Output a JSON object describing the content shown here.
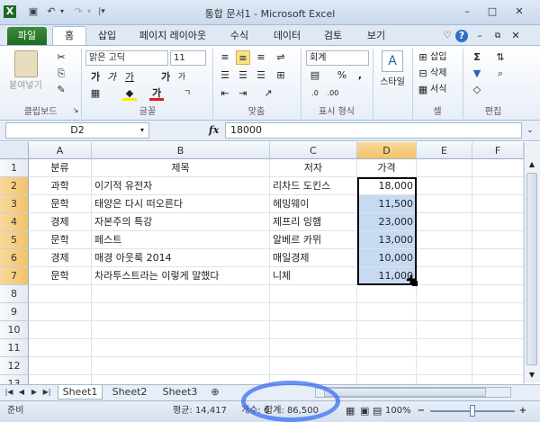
{
  "window": {
    "title": "통합 문서1 - Microsoft Excel"
  },
  "tabs": [
    "파일",
    "홈",
    "삽입",
    "페이지 레이아웃",
    "수식",
    "데이터",
    "검토",
    "보기"
  ],
  "ribbon": {
    "clipboard": {
      "paste": "붙여넣기",
      "label": "클립보드"
    },
    "font": {
      "name": "맑은 고딕",
      "size": "11",
      "label": "글꼴"
    },
    "alignment": {
      "label": "맞춤"
    },
    "number": {
      "format": "회계",
      "label": "표시 형식"
    },
    "styles": {
      "label": "스타일"
    },
    "cells": {
      "insert": "삽입",
      "delete": "삭제",
      "format": "서식",
      "label": "셀"
    },
    "editing": {
      "label": "편집"
    }
  },
  "formula_bar": {
    "name_box": "D2",
    "fx": "fx",
    "value": "18000"
  },
  "columns": [
    "A",
    "B",
    "C",
    "D",
    "E",
    "F"
  ],
  "rows": [
    {
      "num": "1",
      "a": "분류",
      "b": "제목",
      "c": "저자",
      "d": "가격"
    },
    {
      "num": "2",
      "a": "과학",
      "b": "이기적 유전자",
      "c": "리차드 도킨스",
      "d": "18,000"
    },
    {
      "num": "3",
      "a": "문학",
      "b": "태양은 다시 떠오른다",
      "c": "헤밍웨이",
      "d": "11,500"
    },
    {
      "num": "4",
      "a": "경제",
      "b": "자본주의 특강",
      "c": "제프리 잉햄",
      "d": "23,000"
    },
    {
      "num": "5",
      "a": "문학",
      "b": "페스트",
      "c": "알베르 카뮈",
      "d": "13,000"
    },
    {
      "num": "6",
      "a": "경제",
      "b": "매경 아웃룩 2014",
      "c": "매일경제",
      "d": "10,000"
    },
    {
      "num": "7",
      "a": "문학",
      "b": "차라투스트라는 이렇게 말했다",
      "c": "니체",
      "d": "11,000"
    },
    {
      "num": "8"
    },
    {
      "num": "9"
    },
    {
      "num": "10"
    },
    {
      "num": "11"
    },
    {
      "num": "12"
    },
    {
      "num": "13"
    }
  ],
  "sheets": [
    "Sheet1",
    "Sheet2",
    "Sheet3"
  ],
  "status": {
    "ready": "준비",
    "average": "평균: 14,417",
    "count": "개수: 6",
    "sum": "합계: 86,500",
    "zoom": "100%"
  },
  "colors": {
    "accent": "#1f6b21",
    "selection": "#c6dbf2",
    "highlight_circle": "#3a6ff0"
  }
}
